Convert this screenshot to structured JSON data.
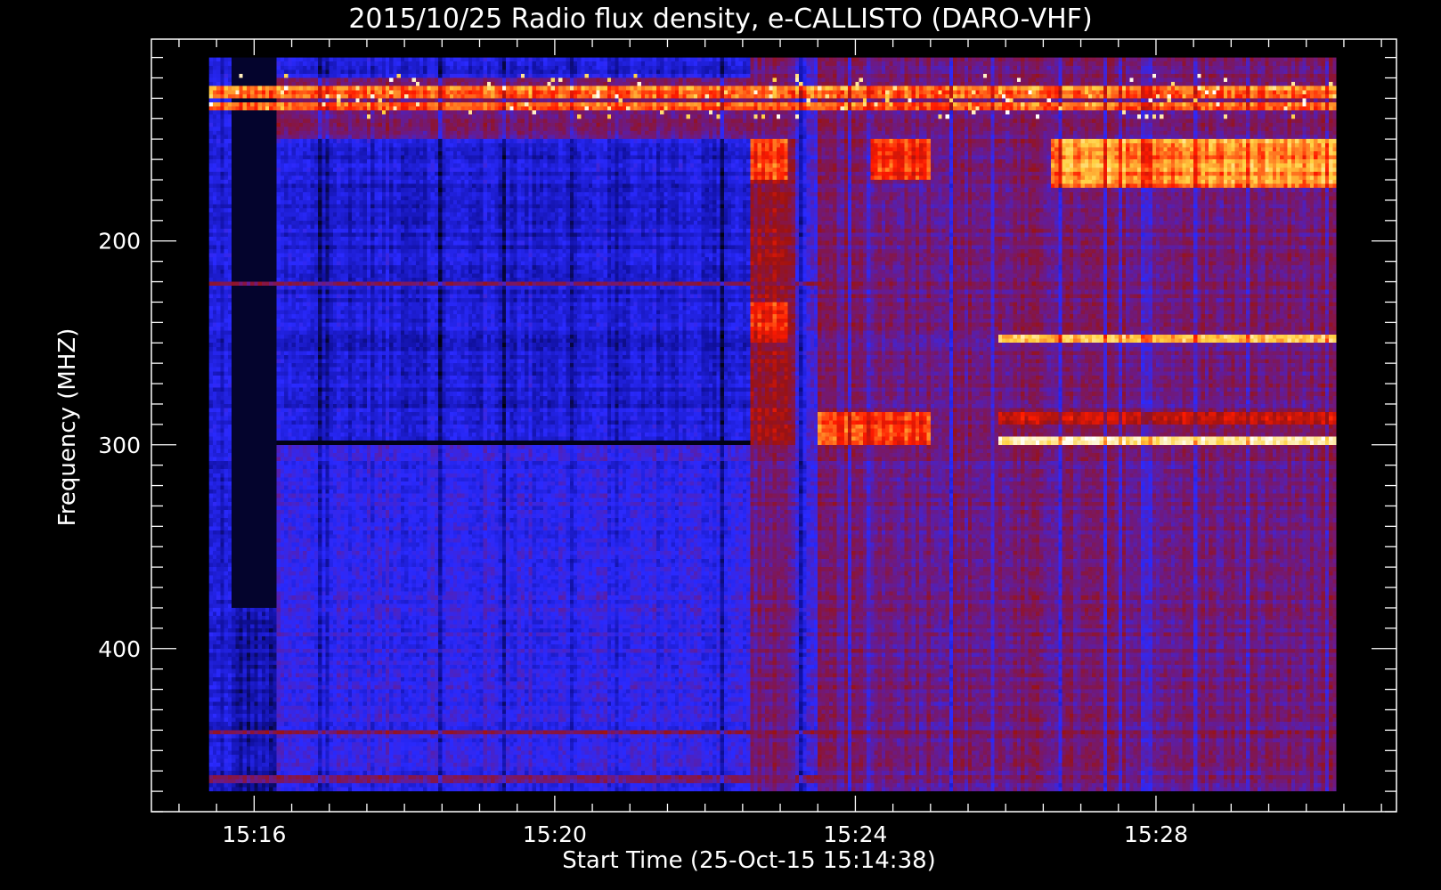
{
  "chart_data": {
    "type": "heatmap",
    "title": "2015/10/25  Radio flux density, e-CALLISTO (DARO-VHF)",
    "xlabel": "Start Time (25-Oct-15 15:14:38)",
    "ylabel": "Frequency (MHZ)",
    "x_unit": "minutes",
    "xlim": [
      14.633,
      31.2
    ],
    "ylim": [
      101,
      480
    ],
    "y_inverted": true,
    "data_xlim": [
      15.4,
      30.4
    ],
    "data_ylim": [
      110,
      470
    ],
    "xticks": [
      {
        "value": 16,
        "label": "15:16"
      },
      {
        "value": 20,
        "label": "15:20"
      },
      {
        "value": 24,
        "label": "15:24"
      },
      {
        "value": 28,
        "label": "15:28"
      }
    ],
    "yticks": [
      {
        "value": 200,
        "label": "200"
      },
      {
        "value": 300,
        "label": "300"
      },
      {
        "value": 400,
        "label": "400"
      }
    ],
    "y_minor_step": 10,
    "x_minor_step": 0.5,
    "colormap": [
      "#000000",
      "#1010a0",
      "#2a2aff",
      "#6a1a8a",
      "#9a1212",
      "#ff1a00",
      "#ffd040",
      "#ffffff"
    ],
    "background_color": "#000000",
    "axes_color": "#ffffff",
    "regions": [
      {
        "x0": 15.4,
        "x1": 30.4,
        "y0": 110,
        "y1": 470,
        "v": 0.3
      },
      {
        "x0": 15.4,
        "x1": 15.7,
        "y0": 110,
        "y1": 470,
        "v": 0.22
      },
      {
        "x0": 15.7,
        "x1": 16.3,
        "y0": 110,
        "y1": 380,
        "v": 0.04
      },
      {
        "x0": 15.7,
        "x1": 16.3,
        "y0": 380,
        "y1": 470,
        "v": 0.16
      },
      {
        "x0": 16.3,
        "x1": 22.6,
        "y0": 110,
        "y1": 300,
        "v": 0.22
      },
      {
        "x0": 16.3,
        "x1": 22.6,
        "y0": 120,
        "y1": 150,
        "v": 0.45
      },
      {
        "x0": 22.6,
        "x1": 30.4,
        "y0": 110,
        "y1": 470,
        "v": 0.45
      },
      {
        "x0": 22.6,
        "x1": 23.2,
        "y0": 150,
        "y1": 300,
        "v": 0.55
      },
      {
        "x0": 23.2,
        "x1": 23.5,
        "y0": 110,
        "y1": 470,
        "v": 0.3
      },
      {
        "x0": 22.6,
        "x1": 23.1,
        "y0": 150,
        "y1": 170,
        "v": 0.72
      },
      {
        "x0": 24.2,
        "x1": 25.0,
        "y0": 150,
        "y1": 170,
        "v": 0.72
      },
      {
        "x0": 26.6,
        "x1": 30.4,
        "y0": 150,
        "y1": 175,
        "v": 0.8
      },
      {
        "x0": 22.6,
        "x1": 23.1,
        "y0": 230,
        "y1": 250,
        "v": 0.68
      },
      {
        "x0": 23.5,
        "x1": 25.0,
        "y0": 285,
        "y1": 300,
        "v": 0.72
      },
      {
        "x0": 25.9,
        "x1": 30.4,
        "y0": 247,
        "y1": 251,
        "v": 0.88
      },
      {
        "x0": 25.9,
        "x1": 30.4,
        "y0": 297,
        "y1": 301,
        "v": 0.92
      },
      {
        "x0": 25.9,
        "x1": 30.4,
        "y0": 284,
        "y1": 290,
        "v": 0.62
      },
      {
        "x0": 15.4,
        "x1": 30.4,
        "y0": 125,
        "y1": 130,
        "v": 0.78
      },
      {
        "x0": 15.4,
        "x1": 30.4,
        "y0": 132,
        "y1": 136,
        "v": 0.74
      },
      {
        "x0": 15.4,
        "x1": 30.4,
        "y0": 220,
        "y1": 223,
        "v": 0.5
      },
      {
        "x0": 15.4,
        "x1": 30.4,
        "y0": 440,
        "y1": 443,
        "v": 0.52
      },
      {
        "x0": 16.3,
        "x1": 22.6,
        "y0": 299,
        "y1": 301,
        "v": 0.02
      },
      {
        "x0": 15.4,
        "x1": 30.4,
        "y0": 462,
        "y1": 466,
        "v": 0.48
      }
    ]
  }
}
